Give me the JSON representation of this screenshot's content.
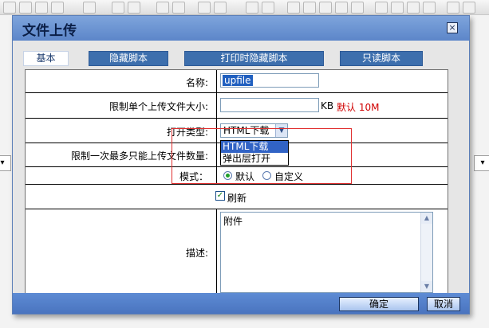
{
  "dialog": {
    "title": "文件上传",
    "close_glyph": "×"
  },
  "tabs": [
    {
      "label": "基本",
      "active": true
    },
    {
      "label": "隐藏脚本",
      "active": false
    },
    {
      "label": "打印时隐藏脚本",
      "active": false
    },
    {
      "label": "只读脚本",
      "active": false
    }
  ],
  "form": {
    "name_label": "名称:",
    "name_value": "upfile",
    "size_label": "限制单个上传文件大小:",
    "size_value": "",
    "size_unit": "KB",
    "size_default": "默认  10M",
    "open_type_label": "打开类型:",
    "open_type_value": "HTML下载",
    "open_type_options": [
      "HTML下载",
      "弹出层打开"
    ],
    "max_count_label": "限制一次最多只能上传文件数量:",
    "mode_label": "模式：",
    "mode_options": [
      {
        "label": "默认",
        "checked": true
      },
      {
        "label": "自定义",
        "checked": false
      }
    ],
    "refresh_label": "刷新",
    "refresh_checked": true,
    "desc_label": "描述:",
    "desc_value": "附件"
  },
  "buttons": {
    "ok_label": "确定",
    "cancel_label": "取消"
  },
  "icons": [
    "close-icon",
    "chevron-down-icon",
    "scroll-up-icon",
    "scroll-down-icon",
    "check-icon"
  ],
  "colors": {
    "title_bar": "#6b93d3",
    "tab_bg": "#3d6fad",
    "accent_red": "#d00000",
    "highlight_border": "#e03030"
  }
}
